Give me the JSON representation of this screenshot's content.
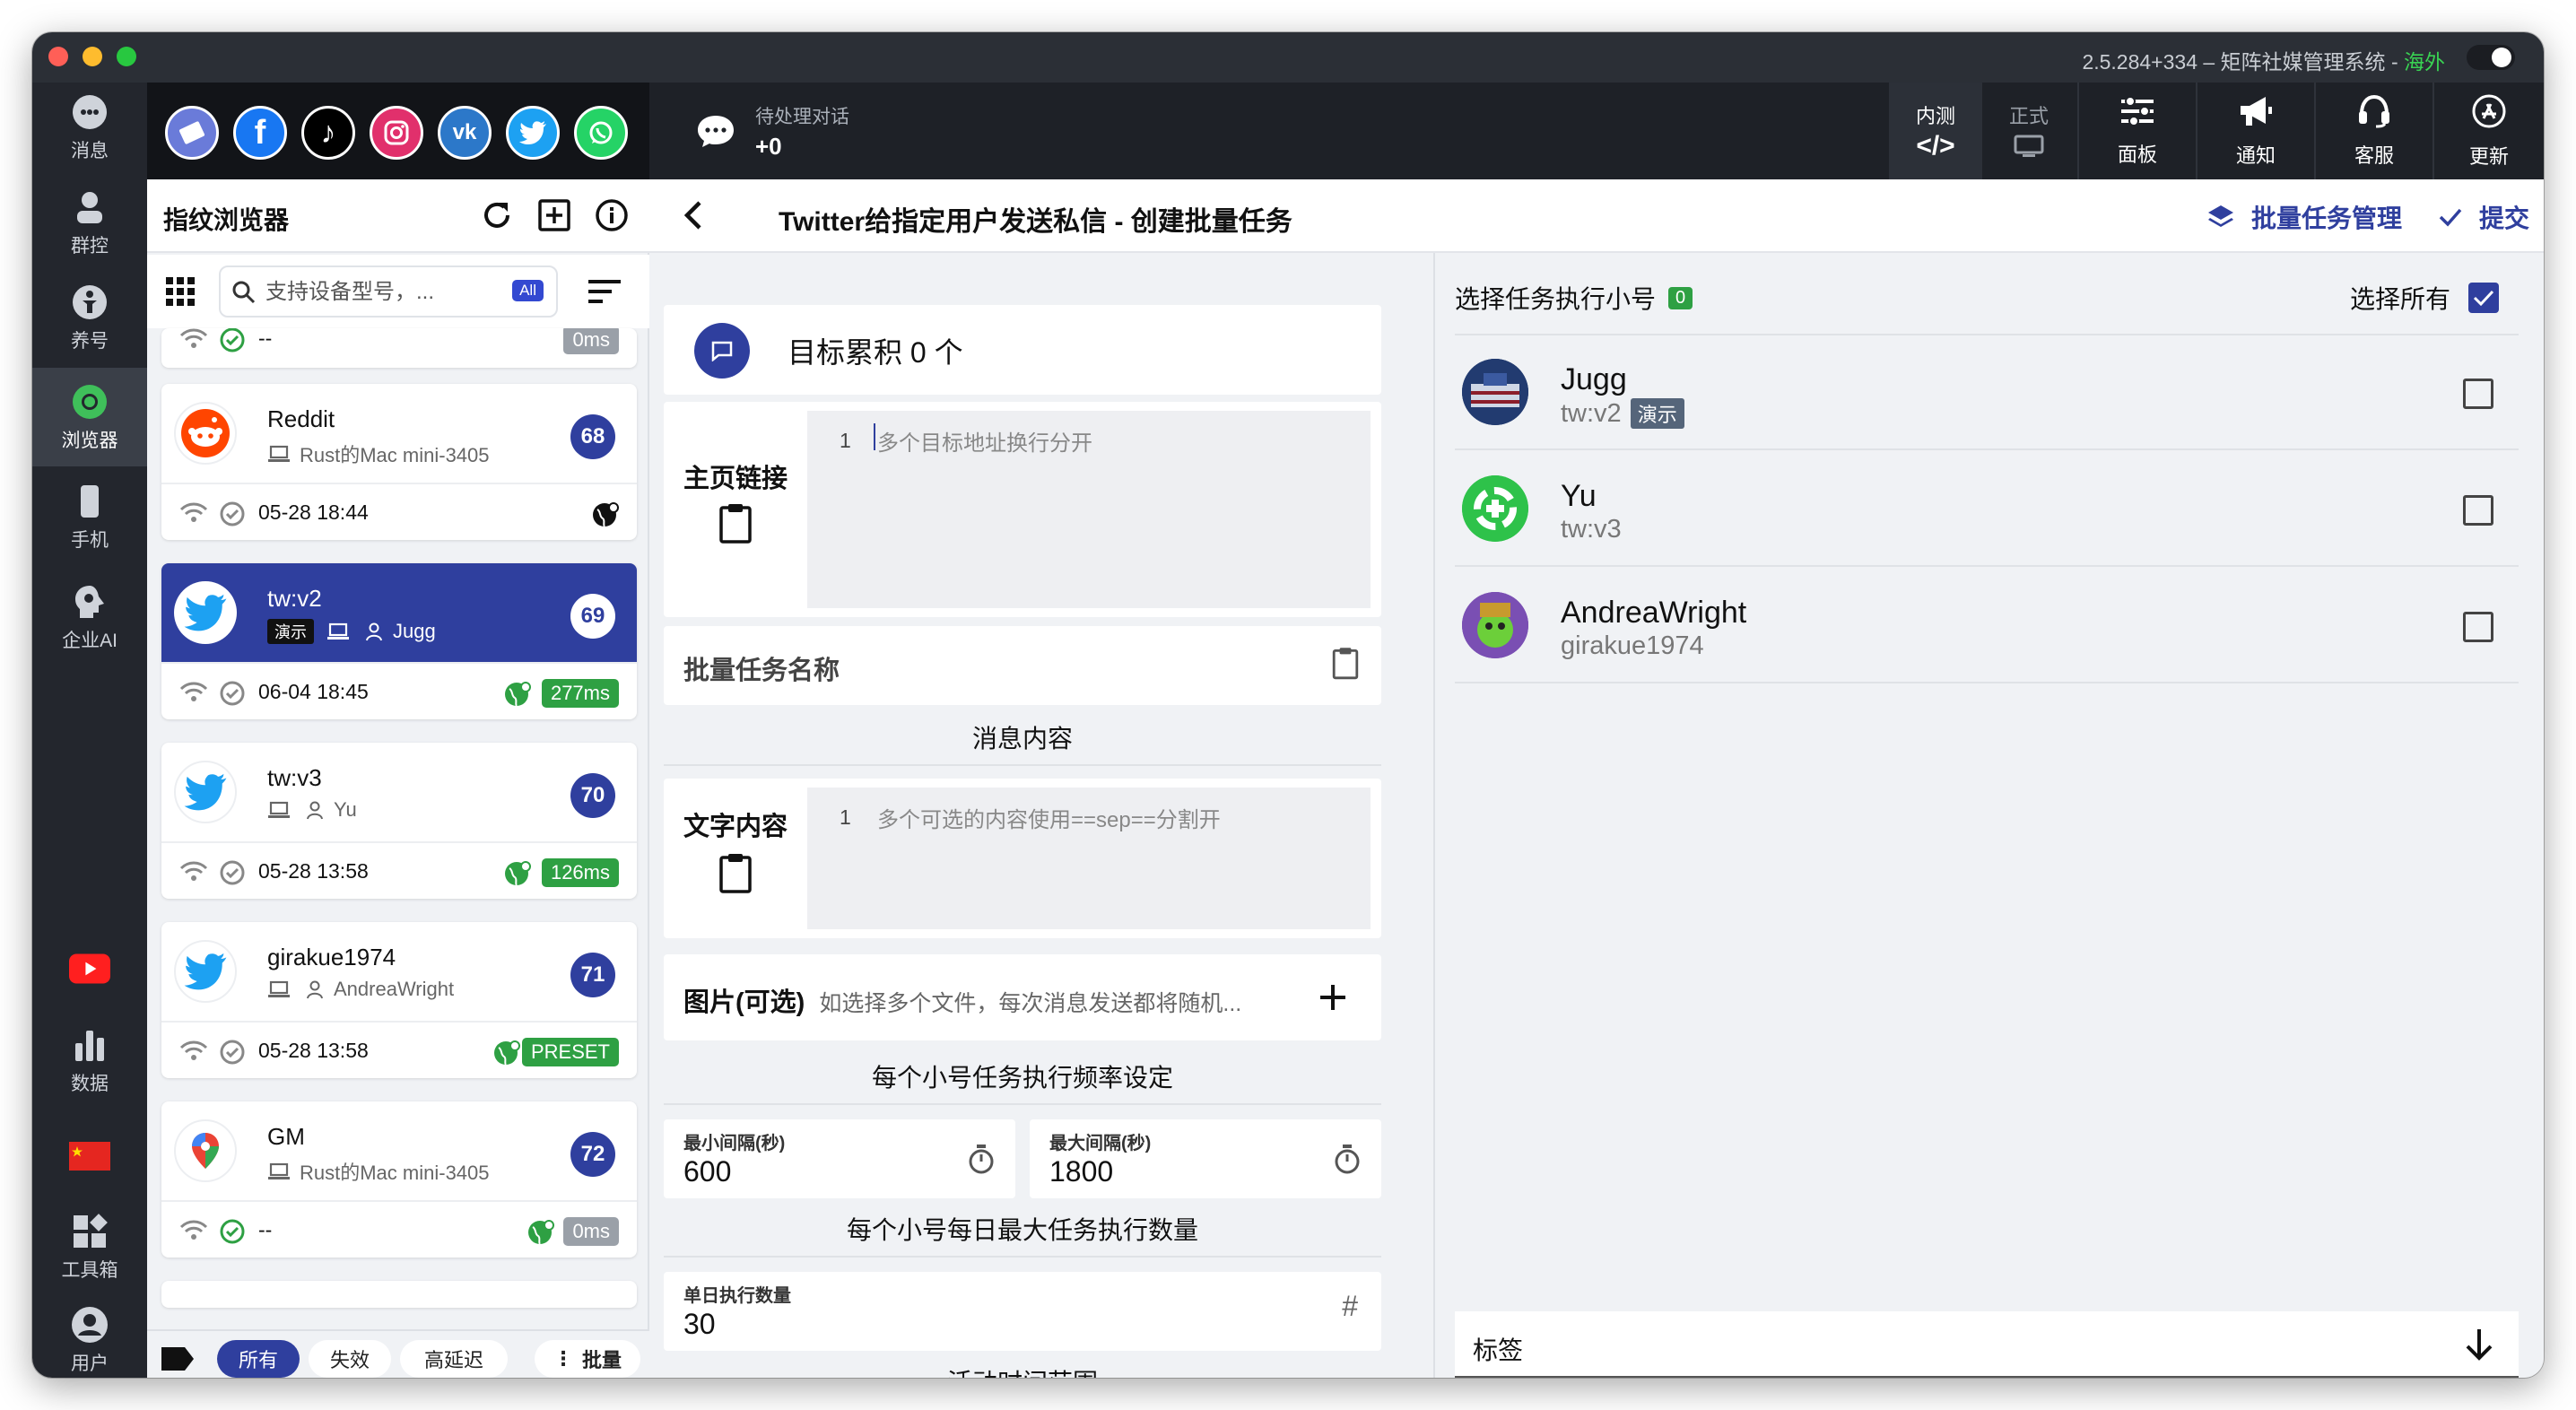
{
  "window": {
    "title_version": "2.5.284+334 – 矩阵社媒管理系统 -",
    "title_region": "海外"
  },
  "rail": {
    "items": [
      {
        "label": "消息",
        "icon": "chat-bot-icon"
      },
      {
        "label": "群控",
        "icon": "group-control-icon"
      },
      {
        "label": "养号",
        "icon": "account-nurture-icon"
      },
      {
        "label": "浏览器",
        "icon": "browser-icon"
      },
      {
        "label": "手机",
        "icon": "phone-icon"
      },
      {
        "label": "企业AI",
        "icon": "enterprise-ai-icon"
      },
      {
        "label": "",
        "icon": "youtube-icon"
      },
      {
        "label": "数据",
        "icon": "data-chart-icon"
      },
      {
        "label": "",
        "icon": "china-flag-icon"
      },
      {
        "label": "工具箱",
        "icon": "toolbox-icon"
      },
      {
        "label": "用户",
        "icon": "user-icon"
      }
    ]
  },
  "topbar": {
    "pending_label": "待处理对话",
    "pending_count": "+0",
    "env_test_label": "内测",
    "env_prod_label": "正式",
    "buttons": [
      {
        "label": "面板",
        "icon": "sliders-icon"
      },
      {
        "label": "通知",
        "icon": "megaphone-icon"
      },
      {
        "label": "客服",
        "icon": "headset-icon"
      },
      {
        "label": "更新",
        "icon": "app-store-icon"
      }
    ]
  },
  "browser_panel": {
    "title": "指纹浏览器",
    "search_placeholder": "支持设备型号，...",
    "search_badge": "All",
    "partial_top_ms": "0ms",
    "partial_top_time": "--",
    "cards": [
      {
        "name": "Reddit",
        "device": "Rust的Mac mini-3405",
        "owner": "",
        "num": "68",
        "time": "05-28 18:44",
        "ms": "",
        "avatar": "reddit"
      },
      {
        "name": "tw:v2",
        "device": "",
        "owner": "Jugg",
        "demo_tag": "演示",
        "num": "69",
        "time": "06-04 18:45",
        "ms": "277ms",
        "avatar": "twitter"
      },
      {
        "name": "tw:v3",
        "device": "",
        "owner": "Yu",
        "num": "70",
        "time": "05-28 13:58",
        "ms": "126ms",
        "avatar": "twitter"
      },
      {
        "name": "girakue1974",
        "device": "",
        "owner": "AndreaWright",
        "num": "71",
        "time": "05-28 13:58",
        "ms": "PRESET",
        "avatar": "twitter"
      },
      {
        "name": "GM",
        "device": "Rust的Mac mini-3405",
        "owner": "",
        "num": "72",
        "time": "--",
        "ms": "0ms",
        "avatar": "maps"
      }
    ],
    "filters": {
      "all": "所有",
      "invalid": "失效",
      "high_latency": "高延迟",
      "batch": "批量"
    }
  },
  "form": {
    "title": "Twitter给指定用户发送私信 - 创建批量任务",
    "manage_label": "批量任务管理",
    "submit_label": "提交",
    "target_text": "目标累积 0 个",
    "homepage_label": "主页链接",
    "homepage_line": "1",
    "homepage_placeholder": "多个目标地址换行分开",
    "task_name_label": "批量任务名称",
    "message_section": "消息内容",
    "text_label": "文字内容",
    "text_line": "1",
    "text_placeholder": "多个可选的内容使用==sep==分割开",
    "image_label": "图片(可选)",
    "image_hint": "如选择多个文件，每次消息发送都将随机...",
    "freq_section": "每个小号任务执行频率设定",
    "min_interval_label": "最小间隔(秒)",
    "min_interval_value": "600",
    "max_interval_label": "最大间隔(秒)",
    "max_interval_value": "1800",
    "daily_section": "每个小号每日最大任务执行数量",
    "daily_label": "单日执行数量",
    "daily_value": "30",
    "active_section": "活动时间范围"
  },
  "accounts": {
    "header": "选择任务执行小号",
    "count": "0",
    "select_all": "选择所有",
    "items": [
      {
        "name": "Jugg",
        "handle": "tw:v2",
        "tag": "演示"
      },
      {
        "name": "Yu",
        "handle": "tw:v3",
        "tag": ""
      },
      {
        "name": "AndreaWright",
        "handle": "girakue1974",
        "tag": ""
      }
    ],
    "tags_label": "标签"
  },
  "colors": {
    "accent": "#2f3f9e",
    "success": "#2ea043",
    "sidebar": "#23262d"
  }
}
